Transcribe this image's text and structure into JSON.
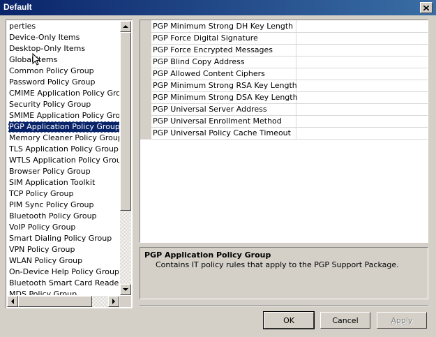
{
  "window": {
    "title": "Default",
    "close_glyph": "✕"
  },
  "list": {
    "items": [
      "perties",
      "Device-Only Items",
      "Desktop-Only Items",
      "Global Items",
      "Common Policy Group",
      "Password Policy Group",
      "CMIME Application Policy Group",
      "Security Policy Group",
      "SMIME Application Policy Group",
      "PGP Application Policy Group",
      "Memory Cleaner Policy Group",
      "TLS Application Policy Group",
      "WTLS Application Policy Group",
      "Browser Policy Group",
      "SIM Application Toolkit",
      "TCP Policy Group",
      "PIM Sync Policy Group",
      "Bluetooth Policy Group",
      "VoIP Policy Group",
      "Smart Dialing Policy Group",
      "VPN Policy Group",
      "WLAN Policy Group",
      "On-Device Help Policy Group",
      "Bluetooth Smart Card Reader Policy Group",
      "MDS Policy Group"
    ],
    "selected": "PGP Application Policy Group"
  },
  "grid": {
    "rows": [
      {
        "name": "PGP Minimum Strong DH Key Length",
        "value": ""
      },
      {
        "name": "PGP Force Digital Signature",
        "value": ""
      },
      {
        "name": "PGP Force Encrypted Messages",
        "value": ""
      },
      {
        "name": "PGP Blind Copy Address",
        "value": ""
      },
      {
        "name": "PGP Allowed Content Ciphers",
        "value": ""
      },
      {
        "name": "PGP Minimum Strong RSA Key Length",
        "value": ""
      },
      {
        "name": "PGP Minimum Strong DSA Key Length",
        "value": ""
      },
      {
        "name": "PGP Universal Server Address",
        "value": ""
      },
      {
        "name": "PGP Universal Enrollment Method",
        "value": ""
      },
      {
        "name": "PGP Universal Policy Cache Timeout",
        "value": ""
      }
    ]
  },
  "description": {
    "title": "PGP Application Policy Group",
    "text": "Contains IT policy rules that apply to the PGP Support Package."
  },
  "buttons": {
    "ok": "OK",
    "cancel": "Cancel",
    "apply": "Apply"
  },
  "colors": {
    "selection": "#0a246a",
    "face": "#d4d0c8",
    "titlebar": "#0a246a"
  }
}
